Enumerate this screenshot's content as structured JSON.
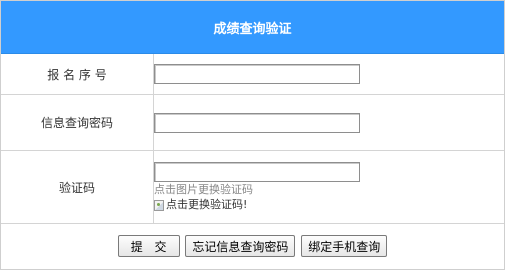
{
  "panel": {
    "title": "成绩查询验证"
  },
  "form": {
    "registration_number": {
      "label": "报 名 序 号",
      "value": ""
    },
    "query_password": {
      "label": "信息查询密码",
      "value": ""
    },
    "captcha": {
      "label": "验证码",
      "value": "",
      "hint": "点击图片更换验证码",
      "image_alt": "点击更换验证码!"
    }
  },
  "actions": {
    "submit_label": "提 交",
    "forgot_label": "忘记信息查询密码",
    "phone_label": "绑定手机查询"
  },
  "colors": {
    "header_bg": "#3399ff",
    "header_text": "#ffffff",
    "hint_text": "#888888"
  }
}
